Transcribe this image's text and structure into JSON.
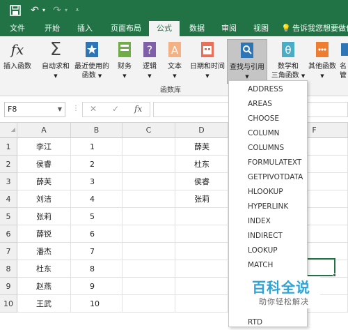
{
  "ribbon_tabs": [
    "文件",
    "开始",
    "插入",
    "页面布局",
    "公式",
    "数据",
    "审阅",
    "视图"
  ],
  "active_tab": "公式",
  "tell_me": "告诉我您想要做什",
  "ribbon_buttons": {
    "insert_function": "插入函数",
    "autosum": "自动求和",
    "recent_line1": "最近使用的",
    "recent_line2": "函数",
    "financial": "财务",
    "logical": "逻辑",
    "text": "文本",
    "datetime": "日期和时间",
    "lookup": "查找与引用",
    "math_line1": "数学和",
    "math_line2": "三角函数",
    "more": "其他函数",
    "partial": "名",
    "partial2": "管"
  },
  "group_label": "函数库",
  "name_box": "F8",
  "fx_label": "fx",
  "columns": [
    "A",
    "B",
    "C",
    "D",
    "F"
  ],
  "rows": [
    {
      "num": "1",
      "a": "李江",
      "b": "1",
      "d": "薛芙"
    },
    {
      "num": "2",
      "a": "侯睿",
      "b": "2",
      "d": "杜东"
    },
    {
      "num": "3",
      "a": "薛芙",
      "b": "3",
      "d": "侯睿"
    },
    {
      "num": "4",
      "a": "刘洁",
      "b": "4",
      "d": "张莉"
    },
    {
      "num": "5",
      "a": "张莉",
      "b": "5",
      "d": ""
    },
    {
      "num": "6",
      "a": "薛锐",
      "b": "6",
      "d": ""
    },
    {
      "num": "7",
      "a": "潘杰",
      "b": "7",
      "d": ""
    },
    {
      "num": "8",
      "a": "杜东",
      "b": "8",
      "d": ""
    },
    {
      "num": "9",
      "a": "赵燕",
      "b": "9",
      "d": ""
    },
    {
      "num": "10",
      "a": "王武",
      "b": "10",
      "d": ""
    }
  ],
  "lookup_menu": [
    "ADDRESS",
    "AREAS",
    "CHOOSE",
    "COLUMN",
    "COLUMNS",
    "FORMULATEXT",
    "GETPIVOTDATA",
    "HLOOKUP",
    "HYPERLINK",
    "INDEX",
    "INDIRECT",
    "LOOKUP",
    "MATCH",
    "RTD"
  ],
  "watermark": {
    "title": "百科全说",
    "subtitle": "助你轻松解决"
  },
  "colors": {
    "excel_green": "#217346",
    "ribbon_bg": "#f3f3f3",
    "watermark_blue": "#2ea3d8"
  }
}
